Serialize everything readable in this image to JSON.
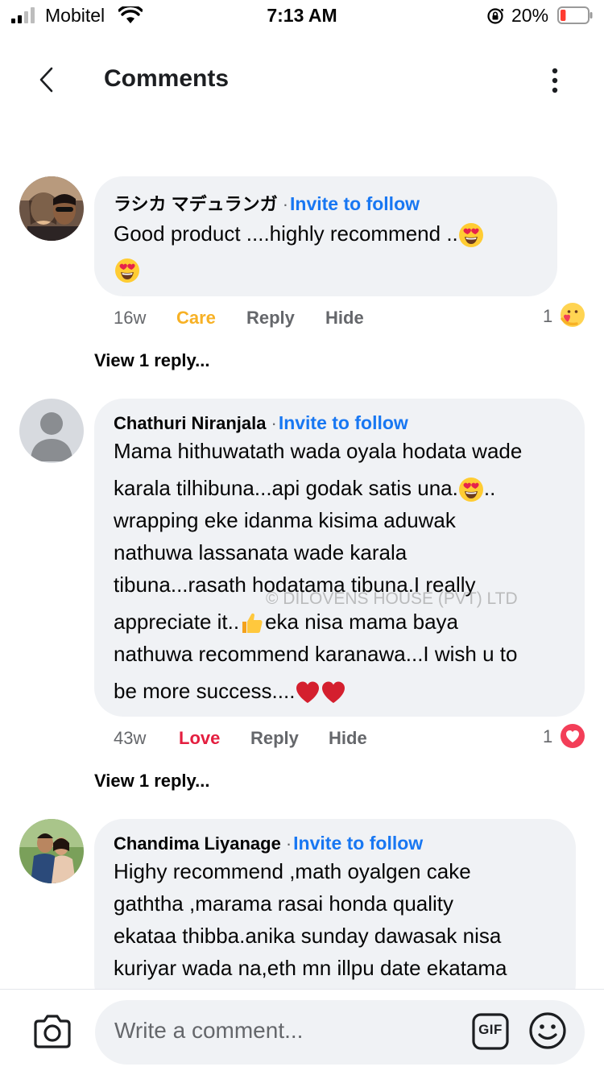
{
  "status_bar": {
    "carrier": "Mobitel",
    "time": "7:13 AM",
    "battery_percent": "20%",
    "battery_level": 0.2,
    "icons": [
      "signal-icon",
      "wifi-icon",
      "orientation-lock-icon",
      "battery-icon"
    ]
  },
  "header": {
    "title": "Comments",
    "icons": [
      "back-chevron-icon",
      "more-options-icon"
    ]
  },
  "watermark": "© DILOVENS HOUSE (PVT) LTD",
  "comments": [
    {
      "author": "ラシカ マデュランガ",
      "follow_label": "Invite to follow",
      "text": "Good  product ....highly recommend ..",
      "emojis": [
        "heart-eyes-emoji",
        "heart-eyes-emoji"
      ],
      "time": "16w",
      "reaction_label": "Care",
      "reply_label": "Reply",
      "hide_label": "Hide",
      "reaction_count": "1",
      "reaction_icon": "care-reaction-icon",
      "view_replies": "View 1 reply..."
    },
    {
      "author": "Chathuri Niranjala",
      "follow_label": "Invite to follow",
      "text_line1": "Mama hithuwatath wada oyala hodata wade",
      "text_line2a": "karala tilhibuna...api godak satis una.",
      "text_line2b": "..",
      "text_line3": "wrapping eke idanma kisima aduwak",
      "text_line4": "nathuwa lassanata wade karala",
      "text_line5": "tibuna...rasath hodatama tibuna.I really",
      "text_line6a": "appreciate it..",
      "text_line6b": "eka nisa mama baya",
      "text_line7": "nathuwa recommend karanawa...I wish u to",
      "text_line8": "be more success....",
      "emojis": [
        "heart-eyes-emoji",
        "thumbs-up-emoji",
        "red-heart-emoji",
        "red-heart-emoji"
      ],
      "time": "43w",
      "reaction_label": "Love",
      "reply_label": "Reply",
      "hide_label": "Hide",
      "reaction_count": "1",
      "reaction_icon": "love-reaction-icon",
      "view_replies": "View 1 reply..."
    },
    {
      "author": "Chandima Liyanage",
      "follow_label": "Invite to follow",
      "text_line1": "Highy recommend ,math oyalgen cake",
      "text_line2": "gaththa ,marama rasai honda quality",
      "text_line3": "ekataa thibba.anika sunday dawasak nisa",
      "text_line4": "kuriyar wada na,eth mn illpu date ekatama"
    }
  ],
  "composer": {
    "placeholder": "Write a comment...",
    "gif_label": "GIF",
    "icons": [
      "camera-icon",
      "gif-icon",
      "emoji-icon"
    ]
  }
}
